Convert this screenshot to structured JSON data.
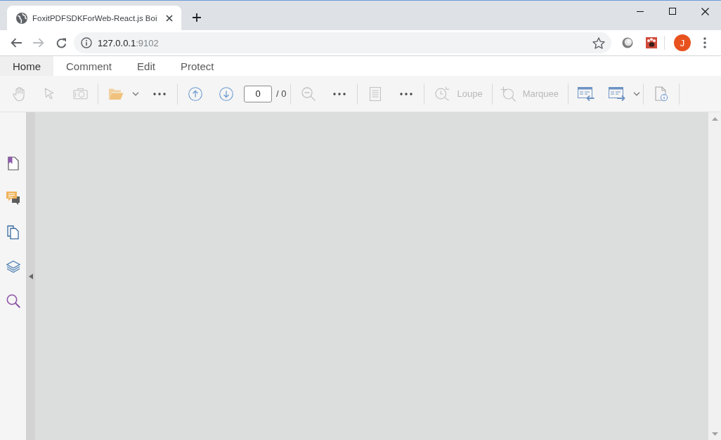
{
  "browser": {
    "tabs": [
      {
        "title": "FoxitPDFSDKForWeb-React.js Boi",
        "selected": true
      }
    ],
    "nav_buttons": [
      {
        "kind": "back",
        "disabled": false
      },
      {
        "kind": "forward",
        "disabled": true
      },
      {
        "kind": "reload",
        "disabled": false
      }
    ],
    "address": {
      "host": "127.0.0.1",
      "port": ":9102"
    },
    "profile": {
      "initial": "J"
    }
  },
  "app": {
    "menu_tabs": [
      {
        "label": "Home",
        "selected": true
      },
      {
        "label": "Comment",
        "selected": false
      },
      {
        "label": "Edit",
        "selected": false
      },
      {
        "label": "Protect",
        "selected": false
      }
    ],
    "toolbar": {
      "groups": [
        [
          {
            "kind": "hand",
            "disabled": true
          },
          {
            "kind": "select",
            "disabled": true
          },
          {
            "kind": "snapshot",
            "disabled": true
          }
        ],
        [
          {
            "kind": "open",
            "disabled": false
          },
          {
            "kind": "dropdown",
            "disabled": false
          },
          {
            "kind": "more",
            "disabled": false
          }
        ],
        [
          {
            "kind": "prev_page",
            "disabled": false
          },
          {
            "kind": "next_page",
            "disabled": false
          },
          {
            "kind": "page_field",
            "value": "0",
            "total": "/ 0"
          }
        ],
        [
          {
            "kind": "zoom_out",
            "disabled": true
          },
          {
            "kind": "more",
            "disabled": false
          }
        ],
        [
          {
            "kind": "page_view",
            "disabled": true
          },
          {
            "kind": "more",
            "disabled": false
          }
        ],
        [
          {
            "kind": "loupe",
            "label": "Loupe",
            "disabled": true
          }
        ],
        [
          {
            "kind": "marquee",
            "label": "Marquee",
            "disabled": true
          }
        ],
        [
          {
            "kind": "import",
            "disabled": false
          },
          {
            "kind": "export",
            "disabled": false
          },
          {
            "kind": "dropdown",
            "disabled": false
          }
        ],
        [
          {
            "kind": "doc_info",
            "disabled": false
          }
        ]
      ]
    },
    "sidebar": {
      "items": [
        {
          "kind": "bookmarks"
        },
        {
          "kind": "comments"
        },
        {
          "kind": "pages"
        },
        {
          "kind": "layers"
        },
        {
          "kind": "search"
        }
      ]
    }
  }
}
